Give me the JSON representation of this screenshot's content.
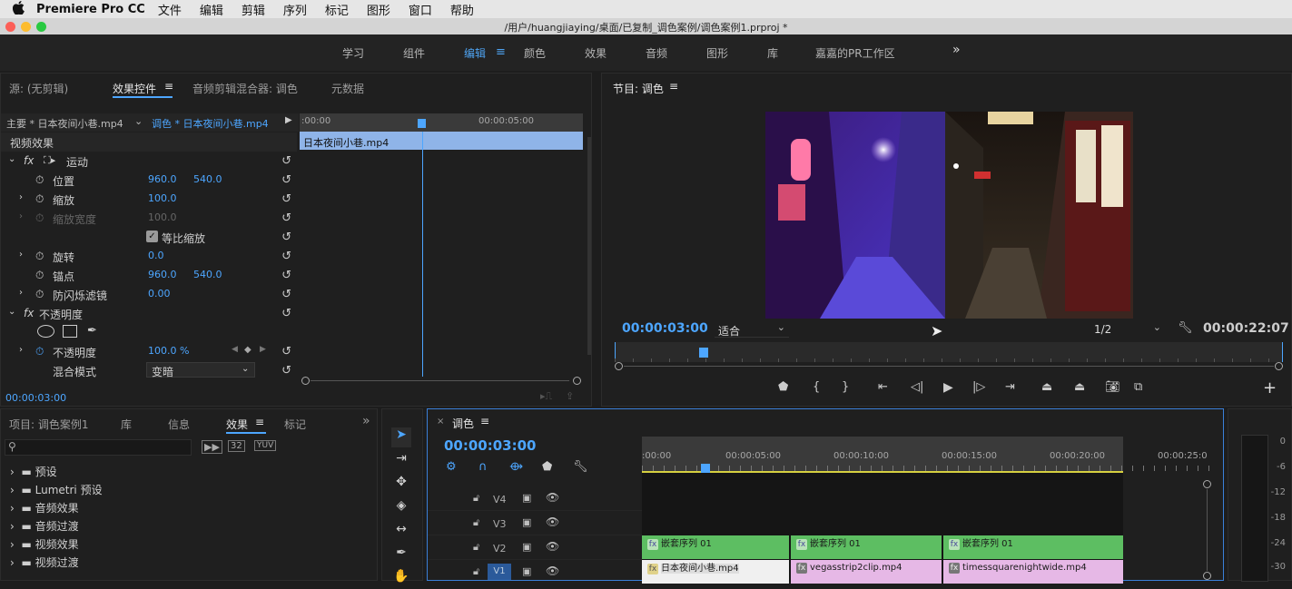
{
  "menubar": {
    "apple": "",
    "app": "Premiere Pro CC",
    "items": [
      "文件",
      "编辑",
      "剪辑",
      "序列",
      "标记",
      "图形",
      "窗口",
      "帮助"
    ]
  },
  "titlebar": {
    "path": "/用户/huangjiaying/桌面/已复制_调色案例/调色案例1.prproj *"
  },
  "workspaces": {
    "items": [
      "学习",
      "组件",
      "编辑",
      "颜色",
      "效果",
      "音频",
      "图形",
      "库",
      "嘉嘉的PR工作区"
    ],
    "active": "编辑",
    "more": "»"
  },
  "source_panel": {
    "tabs": [
      "源: (无剪辑)",
      "效果控件",
      "音频剪辑混合器: 调色",
      "元数据"
    ],
    "active_tab": "效果控件",
    "master_label": "主要 * 日本夜间小巷.mp4",
    "sequence_label": "调色 * 日本夜间小巷.mp4",
    "ruler_start": ":00:00",
    "ruler_mid": "00:00:05:00",
    "clip_name": "日本夜间小巷.mp4",
    "section_video": "视频效果",
    "motion": "运动",
    "position_label": "位置",
    "position_x": "960.0",
    "position_y": "540.0",
    "scale_label": "缩放",
    "scale_value": "100.0",
    "scale_width_label": "缩放宽度",
    "scale_width_value": "100.0",
    "uniform_label": "等比缩放",
    "rotation_label": "旋转",
    "rotation_value": "0.0",
    "anchor_label": "锚点",
    "anchor_x": "960.0",
    "anchor_y": "540.0",
    "flicker_label": "防闪烁滤镜",
    "flicker_value": "0.00",
    "opacity_section": "不透明度",
    "opacity_label": "不透明度",
    "opacity_value": "100.0 %",
    "blend_label": "混合模式",
    "blend_value": "变暗",
    "timecode": "00:00:03:00"
  },
  "program": {
    "title": "节目: 调色",
    "timecode": "00:00:03:00",
    "fit": "适合",
    "resolution": "1/2",
    "duration": "00:00:22:07"
  },
  "project_panel": {
    "tabs": [
      "项目: 调色案例1",
      "库",
      "信息",
      "效果",
      "标记"
    ],
    "active_tab": "效果",
    "folders": [
      "预设",
      "Lumetri 预设",
      "音频效果",
      "音频过渡",
      "视频效果",
      "视频过渡"
    ]
  },
  "timeline": {
    "tab": "调色",
    "timecode": "00:00:03:00",
    "ruler": [
      ":00:00",
      "00:00:05:00",
      "00:00:10:00",
      "00:00:15:00",
      "00:00:20:00",
      "00:00:25:0"
    ],
    "tracks": [
      "V4",
      "V3",
      "V2",
      "V1"
    ],
    "nested": [
      "嵌套序列 01",
      "嵌套序列 01",
      "嵌套序列 01"
    ],
    "v1_clips": [
      "日本夜间小巷.mp4",
      "vegasstrip2clip.mp4",
      "timessquarenightwide.mp4"
    ]
  },
  "meter": {
    "labels": [
      "0",
      "-6",
      "-12",
      "-18",
      "-24",
      "-30"
    ]
  },
  "colors": {
    "accent": "#4da6ff",
    "green_clip": "#5dbe62",
    "pink_clip": "#e6b8e6"
  }
}
